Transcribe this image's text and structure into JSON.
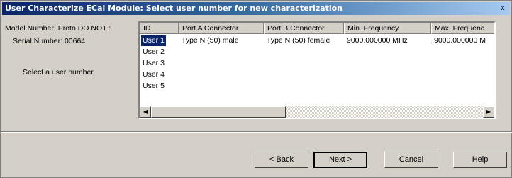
{
  "window": {
    "title": "User Characterize ECal Module: Select user number for new characterization",
    "close_glyph": "x"
  },
  "info": {
    "model_number": "Model Number: Proto DO NOT :",
    "serial_number": "Serial Number: 00664",
    "prompt": "Select a user number"
  },
  "table": {
    "columns": [
      "ID",
      "Port A Connector",
      "Port B Connector",
      "Min. Frequency",
      "Max. Frequenc"
    ],
    "rows": [
      {
        "id": "User 1",
        "port_a": "Type N (50) male",
        "port_b": "Type N (50) female",
        "min_freq": "9000.000000 MHz",
        "max_freq": "9000.000000 M",
        "selected": true
      },
      {
        "id": "User 2",
        "port_a": "",
        "port_b": "",
        "min_freq": "",
        "max_freq": "",
        "selected": false
      },
      {
        "id": "User 3",
        "port_a": "",
        "port_b": "",
        "min_freq": "",
        "max_freq": "",
        "selected": false
      },
      {
        "id": "User 4",
        "port_a": "",
        "port_b": "",
        "min_freq": "",
        "max_freq": "",
        "selected": false
      },
      {
        "id": "User 5",
        "port_a": "",
        "port_b": "",
        "min_freq": "",
        "max_freq": "",
        "selected": false
      }
    ]
  },
  "scrollbar": {
    "left_arrow": "◀",
    "right_arrow": "▶"
  },
  "buttons": {
    "back": "< Back",
    "next": "Next >",
    "cancel": "Cancel",
    "help": "Help"
  }
}
